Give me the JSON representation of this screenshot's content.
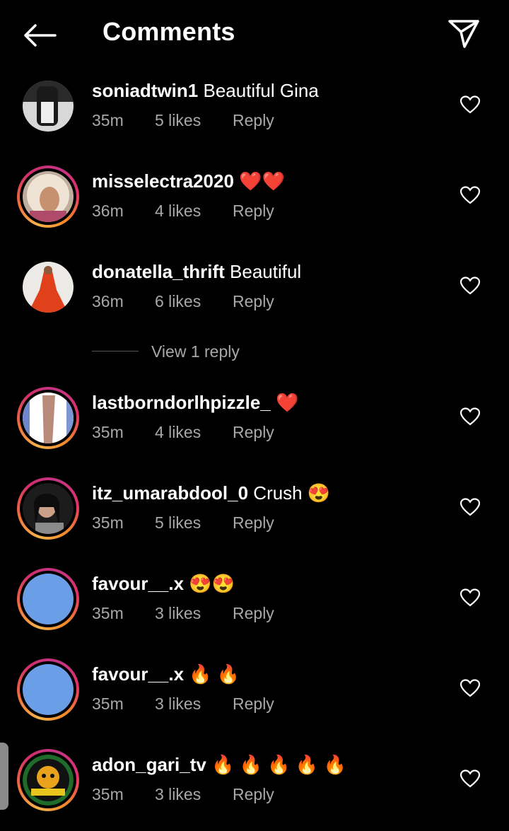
{
  "header": {
    "title": "Comments",
    "back_icon": "arrow-left-icon",
    "send_icon": "paper-plane-icon"
  },
  "colors": {
    "background": "#000000",
    "text": "#ffffff",
    "meta": "#a8a8a8",
    "story_ring_start": "#f7b24a",
    "story_ring_end": "#c13584",
    "default_avatar": "#6a9fe8"
  },
  "comments": [
    {
      "username": "soniadtwin1",
      "text": " Beautiful Gina",
      "emoji": "",
      "time": "35m",
      "likes": "5 likes",
      "reply": "Reply",
      "story_ring": false
    },
    {
      "username": "misselectra2020",
      "text": " ",
      "emoji": "❤️❤️",
      "time": "36m",
      "likes": "4 likes",
      "reply": "Reply",
      "story_ring": true
    },
    {
      "username": "donatella_thrift",
      "text": " Beautiful",
      "emoji": "",
      "time": "36m",
      "likes": "6 likes",
      "reply": "Reply",
      "story_ring": false
    },
    {
      "username": "lastborndorlhpizzle_",
      "text": " ",
      "emoji": "❤️",
      "time": "35m",
      "likes": "4 likes",
      "reply": "Reply",
      "story_ring": true
    },
    {
      "username": "itz_umarabdool_0",
      "text": " Crush ",
      "emoji": "😍",
      "time": "35m",
      "likes": "5 likes",
      "reply": "Reply",
      "story_ring": true
    },
    {
      "username": "favour__.x",
      "text": " ",
      "emoji": "😍😍",
      "time": "35m",
      "likes": "3 likes",
      "reply": "Reply",
      "story_ring": true
    },
    {
      "username": "favour__.x",
      "text": " ",
      "emoji": "🔥 🔥",
      "time": "35m",
      "likes": "3 likes",
      "reply": "Reply",
      "story_ring": true
    },
    {
      "username": "adon_gari_tv",
      "text": " ",
      "emoji": "🔥 🔥 🔥 🔥 🔥",
      "time": "35m",
      "likes": "3 likes",
      "reply": "Reply",
      "story_ring": true
    }
  ],
  "view_replies": {
    "label": "View 1 reply"
  }
}
